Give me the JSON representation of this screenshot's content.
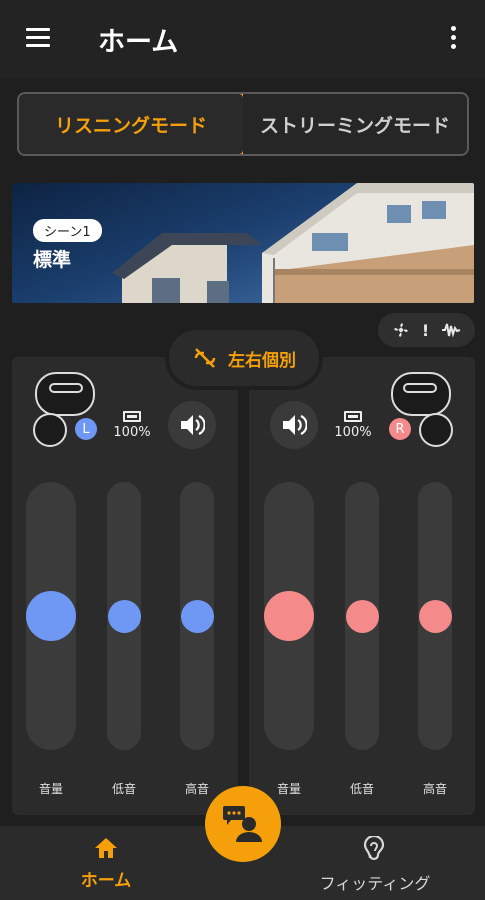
{
  "appbar": {
    "title": "ホーム",
    "menu_icon": "hamburger-menu-icon",
    "more_icon": "more-vert-icon"
  },
  "modes": {
    "listening": "リスニングモード",
    "streaming": "ストリーミングモード",
    "active": "listening"
  },
  "scene": {
    "tag": "シーン1",
    "name": "標準"
  },
  "status_chip": {
    "icons": [
      "fan-icon",
      "alert-icon",
      "waveform-icon"
    ],
    "alert_text": "!"
  },
  "separate_button": {
    "label": "左右個別",
    "icon": "link-off-icon"
  },
  "left": {
    "side": "L",
    "badge_color": "#6f98f5",
    "battery": "100%",
    "sliders": [
      {
        "label": "音量",
        "level": 0.5
      },
      {
        "label": "低音",
        "level": 0.5
      },
      {
        "label": "高音",
        "level": 0.5
      }
    ]
  },
  "right": {
    "side": "R",
    "badge_color": "#f48a8a",
    "battery": "100%",
    "sliders": [
      {
        "label": "音量",
        "level": 0.5
      },
      {
        "label": "低音",
        "level": 0.5
      },
      {
        "label": "高音",
        "level": 0.5
      }
    ]
  },
  "bottom_nav": {
    "home": "ホーム",
    "fitting": "フィッティング"
  },
  "colors": {
    "accent": "#f5a00a",
    "left": "#6f98f5",
    "right": "#f48a8a"
  }
}
